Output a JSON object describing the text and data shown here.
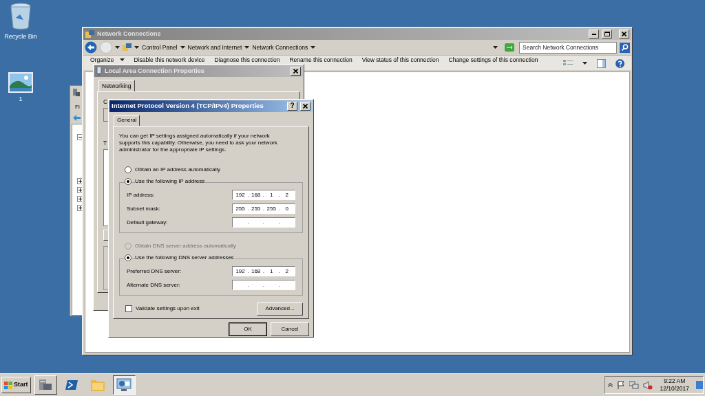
{
  "desktop_icons": [
    {
      "label": "Recycle Bin",
      "kind": "recycle"
    },
    {
      "label": "1"
    }
  ],
  "background_window": {
    "menu_fragment": "Fi",
    "tree_expanders": [
      {
        "expanded": true
      },
      {
        "expanded": false
      },
      {
        "expanded": false
      },
      {
        "expanded": false
      },
      {
        "expanded": false
      }
    ]
  },
  "network_connections": {
    "title": "Network Connections",
    "active": false,
    "breadcrumb": [
      "Control Panel",
      "Network and Internet",
      "Network Connections"
    ],
    "search": {
      "placeholder": "Search Network Connections"
    },
    "toolbar": [
      {
        "label": "Organize",
        "dropdown": true
      },
      {
        "label": "Disable this network device",
        "dropdown": false
      },
      {
        "label": "Diagnose this connection",
        "dropdown": false
      },
      {
        "label": "Rename this connection",
        "dropdown": false
      },
      {
        "label": "View status of this connection",
        "dropdown": false
      },
      {
        "label": "Change settings of this connection",
        "dropdown": false
      }
    ]
  },
  "lan_properties": {
    "title": "Local Area Connection Properties",
    "active": false,
    "tabs": [
      {
        "label": "Networking",
        "selected": true
      }
    ],
    "label_fragments": [
      "C",
      "T"
    ]
  },
  "ipv4_dialog": {
    "title": "Internet Protocol Version 4 (TCP/IPv4) Properties",
    "active": true,
    "help_glyph": "?",
    "tabs": [
      {
        "label": "General",
        "selected": true
      }
    ],
    "intro": "You can get IP settings assigned automatically if your network supports this capability. Otherwise, you need to ask your network administrator for the appropriate IP settings.",
    "separator": ".",
    "ip_mode": [
      {
        "label": "Obtain an IP address automatically",
        "selected": false,
        "disabled": false
      },
      {
        "label": "Use the following IP address",
        "selected": true,
        "disabled": false
      }
    ],
    "ip_fields": [
      {
        "label": "IP address:",
        "octets": [
          "192",
          "168",
          "1",
          "2"
        ]
      },
      {
        "label": "Subnet mask:",
        "octets": [
          "255",
          "255",
          "255",
          "0"
        ]
      },
      {
        "label": "Default gateway:"
      }
    ],
    "dns_mode": [
      {
        "label": "Obtain DNS server address automatically",
        "selected": false,
        "disabled": true
      },
      {
        "label": "Use the following DNS server addresses",
        "selected": true,
        "disabled": false
      }
    ],
    "dns_fields": [
      {
        "label": "Preferred DNS server:",
        "octets": [
          "192",
          "168",
          "1",
          "2"
        ]
      },
      {
        "label": "Alternate DNS server:"
      }
    ],
    "validate": {
      "label": "Validate settings upon exit",
      "checked": false
    },
    "advanced_button": "Advanced...",
    "buttons": [
      {
        "label": "OK",
        "default": true
      },
      {
        "label": "Cancel",
        "default": false
      }
    ]
  },
  "taskbar": {
    "start": "Start",
    "apps": [
      {
        "kind": "server",
        "active": false
      },
      {
        "kind": "shell",
        "active": false
      },
      {
        "kind": "folder",
        "active": false
      },
      {
        "kind": "network",
        "active": true
      }
    ],
    "time": "9:22 AM",
    "date": "12/10/2017"
  }
}
